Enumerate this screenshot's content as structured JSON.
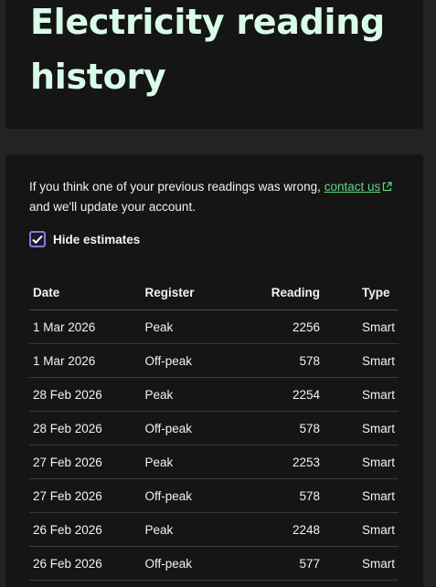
{
  "header": {
    "title": "Electricity reading history"
  },
  "intro": {
    "text_before": "If you think one of your previous readings was wrong, ",
    "link_label": "contact us",
    "text_after": " and we'll update your account."
  },
  "filter": {
    "label": "Hide estimates",
    "checked": true
  },
  "table": {
    "columns": {
      "date": "Date",
      "register": "Register",
      "reading": "Reading",
      "type": "Type"
    },
    "rows": [
      {
        "date": "1 Mar 2026",
        "register": "Peak",
        "reading": "2256",
        "type": "Smart"
      },
      {
        "date": "1 Mar 2026",
        "register": "Off-peak",
        "reading": "578",
        "type": "Smart"
      },
      {
        "date": "28 Feb 2026",
        "register": "Peak",
        "reading": "2254",
        "type": "Smart"
      },
      {
        "date": "28 Feb 2026",
        "register": "Off-peak",
        "reading": "578",
        "type": "Smart"
      },
      {
        "date": "27 Feb 2026",
        "register": "Peak",
        "reading": "2253",
        "type": "Smart"
      },
      {
        "date": "27 Feb 2026",
        "register": "Off-peak",
        "reading": "578",
        "type": "Smart"
      },
      {
        "date": "26 Feb 2026",
        "register": "Peak",
        "reading": "2248",
        "type": "Smart"
      },
      {
        "date": "26 Feb 2026",
        "register": "Off-peak",
        "reading": "577",
        "type": "Smart"
      }
    ]
  },
  "colors": {
    "title": "#d9fbe9",
    "link": "#5fd983",
    "checkbox": "#7e7be0",
    "card": "#151515",
    "page": "#232323"
  }
}
